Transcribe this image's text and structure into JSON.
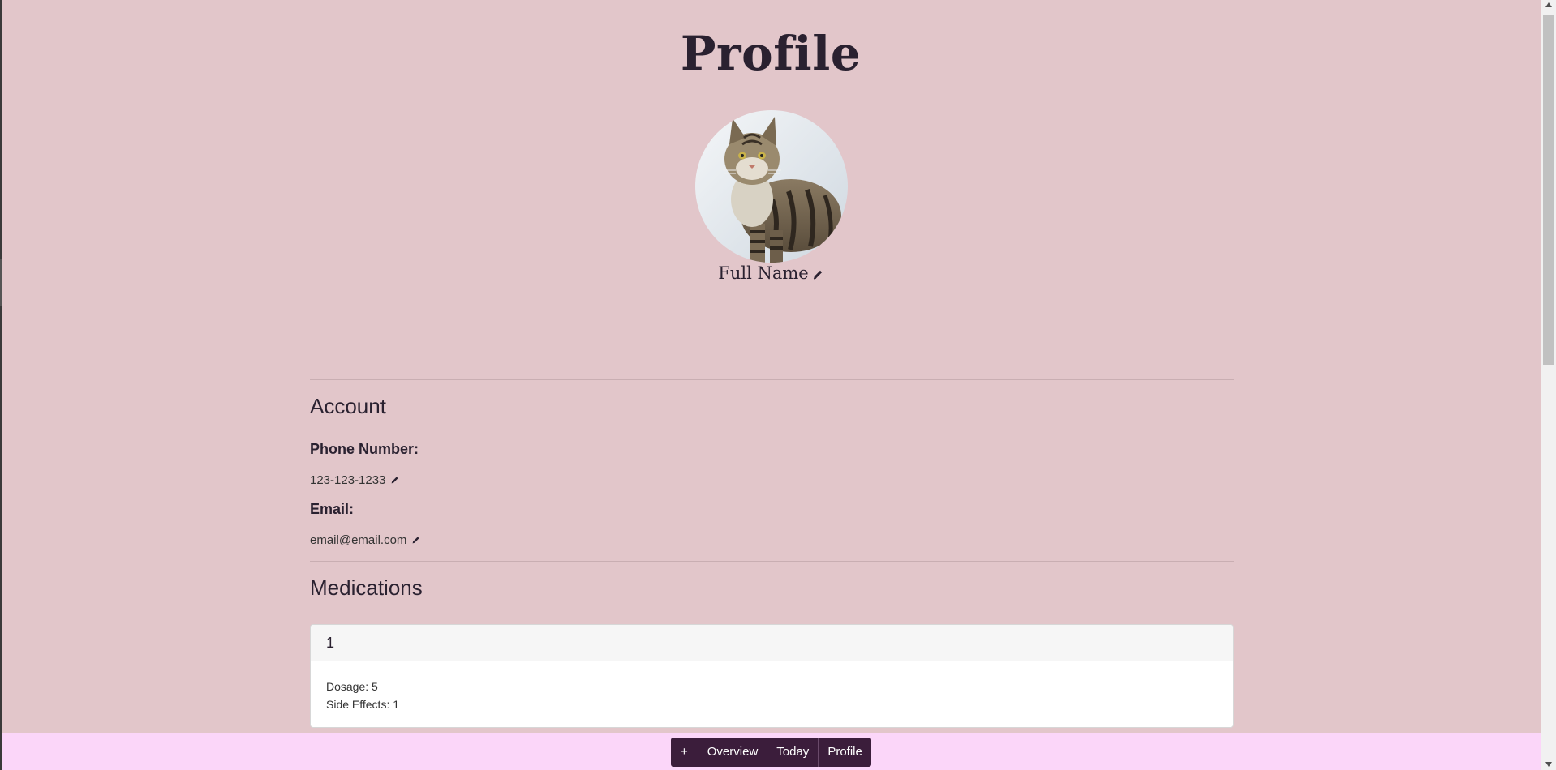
{
  "page": {
    "title": "Profile"
  },
  "profile": {
    "full_name": "Full Name",
    "avatar_icon": "cat-photo"
  },
  "account": {
    "heading": "Account",
    "phone_label": "Phone Number:",
    "phone_value": "123-123-1233",
    "email_label": "Email:",
    "email_value": "email@email.com"
  },
  "medications": {
    "heading": "Medications",
    "items": [
      {
        "name": "1",
        "dosage": "Dosage: 5",
        "side_effects": "Side Effects: 1"
      }
    ]
  },
  "nav": {
    "add_label": "+",
    "overview_label": "Overview",
    "today_label": "Today",
    "profile_label": "Profile"
  },
  "colors": {
    "background": "#e2c6ca",
    "nav_bar": "#fbd6f9",
    "nav_button": "#3b1d3b"
  }
}
